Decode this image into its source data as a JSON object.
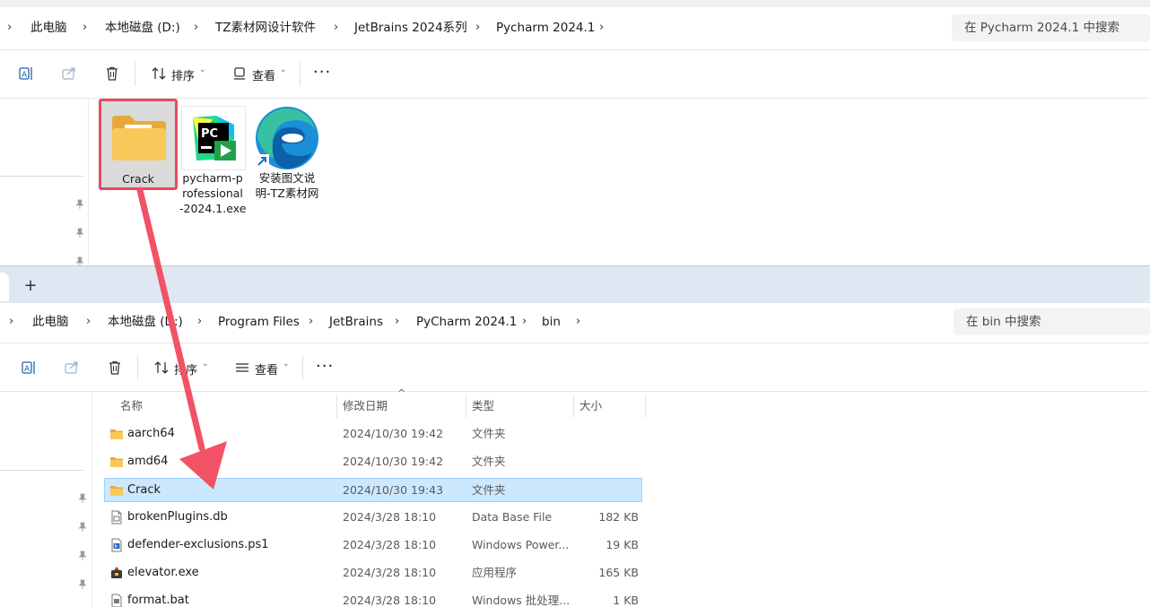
{
  "top_window": {
    "breadcrumbs": [
      "此电脑",
      "本地磁盘 (D:)",
      "TZ素材网设计软件",
      "JetBrains 2024系列",
      "Pycharm 2024.1"
    ],
    "search_placeholder": "在 Pycharm 2024.1 中搜索",
    "toolbar": {
      "sort_label": "排序",
      "view_label": "查看"
    },
    "items": [
      {
        "name": "Crack",
        "icon": "folder-icon",
        "highlighted": true
      },
      {
        "name_lines": [
          "pycharm-p",
          "rofessional",
          "-2024.1.exe"
        ],
        "icon": "pycharm-icon"
      },
      {
        "name_lines": [
          "安装图文说",
          "明-TZ素材网"
        ],
        "icon": "edge-shortcut-icon"
      }
    ]
  },
  "bottom_window": {
    "new_tab_label": "+",
    "breadcrumbs": [
      "此电脑",
      "本地磁盘 (D:)",
      "Program Files",
      "JetBrains",
      "PyCharm 2024.1",
      "bin"
    ],
    "search_placeholder": "在 bin 中搜索",
    "toolbar": {
      "sort_label": "排序",
      "view_label": "查看"
    },
    "columns": {
      "name": "名称",
      "date": "修改日期",
      "type": "类型",
      "size": "大小"
    },
    "files": [
      {
        "name": "aarch64",
        "date": "2024/10/30 19:42",
        "type": "文件夹",
        "size": "",
        "icon": "folder-icon"
      },
      {
        "name": "amd64",
        "date": "2024/10/30 19:42",
        "type": "文件夹",
        "size": "",
        "icon": "folder-icon"
      },
      {
        "name": "Crack",
        "date": "2024/10/30 19:43",
        "type": "文件夹",
        "size": "",
        "icon": "folder-icon",
        "selected": true
      },
      {
        "name": "brokenPlugins.db",
        "date": "2024/3/28 18:10",
        "type": "Data Base File",
        "size": "182 KB",
        "icon": "file-icon"
      },
      {
        "name": "defender-exclusions.ps1",
        "date": "2024/3/28 18:10",
        "type": "Windows Power...",
        "size": "19 KB",
        "icon": "powershell-file-icon"
      },
      {
        "name": "elevator.exe",
        "date": "2024/3/28 18:10",
        "type": "应用程序",
        "size": "165 KB",
        "icon": "exe-icon"
      },
      {
        "name": "format.bat",
        "date": "2024/3/28 18:10",
        "type": "Windows 批处理...",
        "size": "1 KB",
        "icon": "bat-file-icon"
      }
    ]
  },
  "colors": {
    "highlight_border": "#e84a5f",
    "arrow": "#f25266",
    "selection": "#cce8ff",
    "tab_strip": "#dfe8f2"
  }
}
